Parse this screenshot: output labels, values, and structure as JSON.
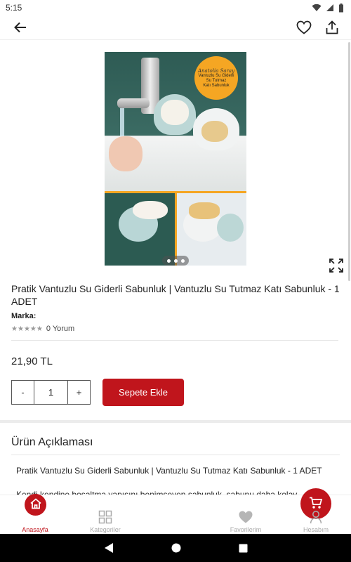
{
  "status_bar": {
    "time": "5:15"
  },
  "product": {
    "image_badge": {
      "script": "Anatolia Saray",
      "lines": [
        "Vantuzlu Su Giderli",
        "Su Tutmaz",
        "Katı Sabunluk"
      ]
    },
    "image_indicator": {
      "count": 3,
      "active": 0
    },
    "title": "Pratik Vantuzlu Su Giderli Sabunluk | Vantuzlu Su Tutmaz Katı Sabunluk - 1 ADET",
    "brand_label": "Marka:",
    "rating": {
      "stars": 5,
      "filled": 0,
      "reviews_text": "0 Yorum"
    },
    "price": "21,90 TL",
    "quantity": {
      "decrement": "-",
      "value": "1",
      "increment": "+"
    },
    "add_to_cart": "Sepete Ekle"
  },
  "description": {
    "heading": "Ürün Açıklaması",
    "line1": "Pratik Vantuzlu Su Giderli Sabunluk | Vantuzlu Su Tutmaz Katı Sabunluk - 1 ADET",
    "line2": "Kendi kendine bosaltma yapısını benimseyen sabunluk, sabunu daha kolay"
  },
  "bottom_nav": {
    "home": "Anasayfa",
    "categories": "Kategoriler",
    "favorites": "Favorilerim",
    "account": "Hesabım"
  },
  "colors": {
    "accent": "#c0151c",
    "badge": "#f5a623"
  }
}
